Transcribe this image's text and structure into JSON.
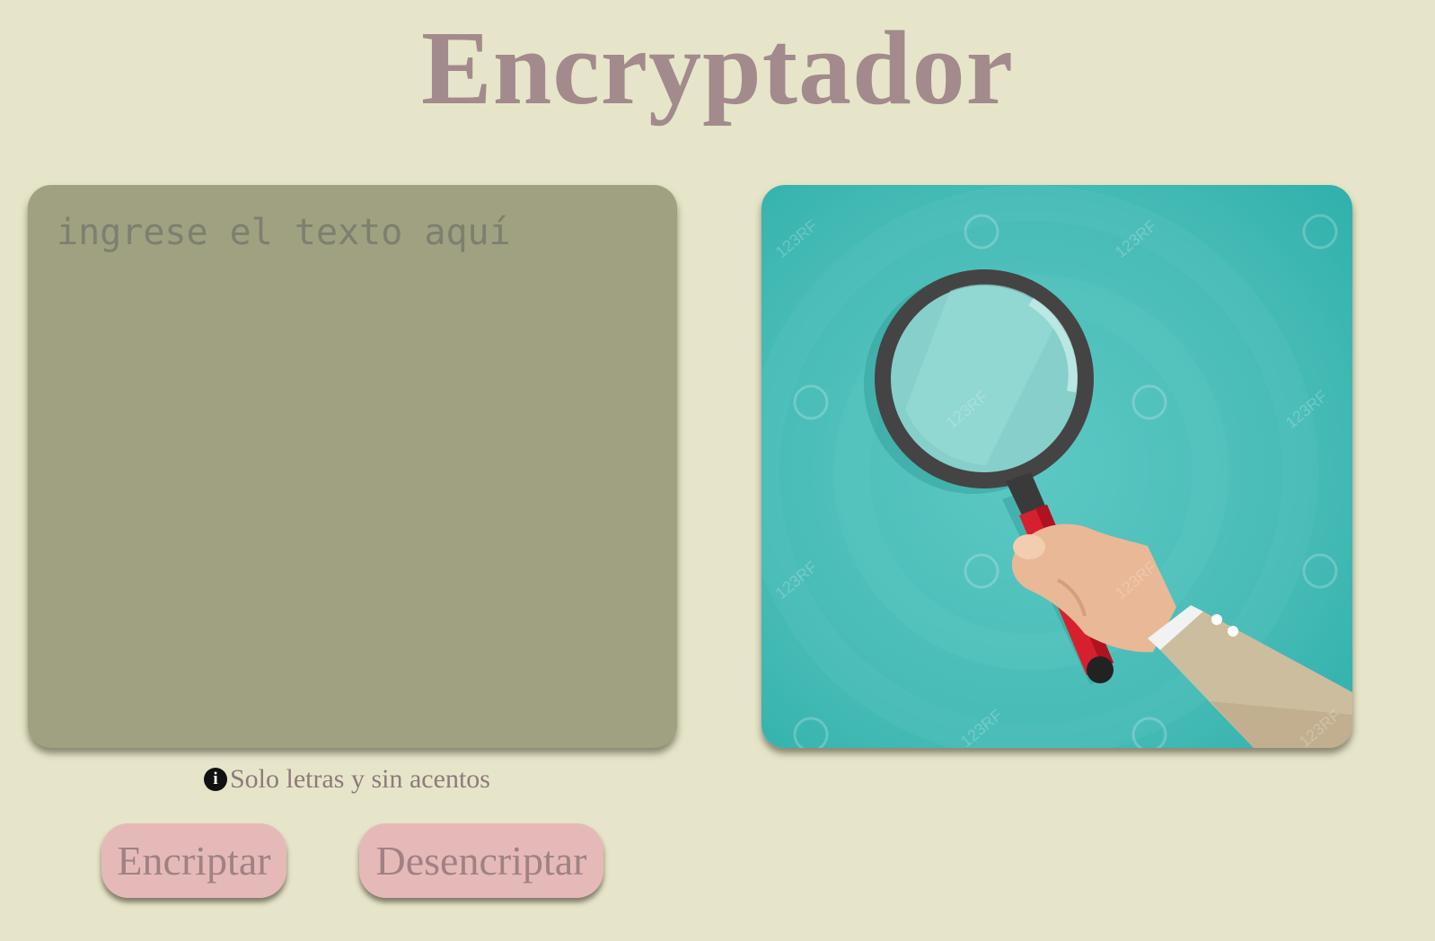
{
  "header": {
    "title": "Encryptador"
  },
  "input": {
    "placeholder": "ingrese el texto aquí",
    "value": ""
  },
  "illustration": {
    "subject": "hand-holding-magnifying-glass",
    "watermark": "123RF"
  },
  "hint": {
    "icon": "info-icon",
    "text": "Solo letras y sin acentos"
  },
  "actions": {
    "encrypt_label": "Encriptar",
    "decrypt_label": "Desencriptar"
  },
  "colors": {
    "background": "#e6e5c9",
    "title": "#a38a8c",
    "input_panel": "#9fa181",
    "button": "#e6b9b9",
    "button_text": "#a08283",
    "illustration_bg": "#45bbb6"
  }
}
